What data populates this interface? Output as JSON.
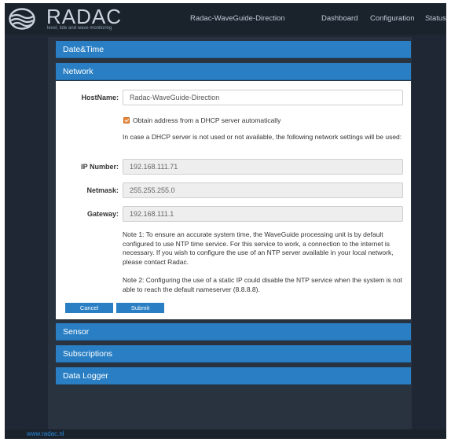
{
  "brand": {
    "name": "RADAC",
    "tagline": "level, tide and wave monitoring"
  },
  "nav": {
    "title": "Radac-WaveGuide-Direction",
    "links": [
      "Dashboard",
      "Configuration",
      "Status"
    ]
  },
  "panels": {
    "datetime": "Date&Time",
    "network": "Network",
    "sensor": "Sensor",
    "subscriptions": "Subscriptions",
    "datalogger": "Data Logger"
  },
  "network": {
    "hostname_label": "HostName:",
    "hostname_value": "Radac-WaveGuide-Direction",
    "dhcp_label": "Obtain address from a DHCP server automatically",
    "dhcp_checked": true,
    "fallback_note": "In case a DHCP server is not used or not available, the following network settings will be used:",
    "ip_label": "IP Number:",
    "ip_value": "192.168.111.71",
    "netmask_label": "Netmask:",
    "netmask_value": "255.255.255.0",
    "gateway_label": "Gateway:",
    "gateway_value": "192.168.111.1",
    "note1": "Note 1: To ensure an accurate system time, the WaveGuide processing unit is by default configured to use NTP time service. For this service to work, a connection to the internet is necessary. If you wish to configure the use of an NTP server available in your local network, please contact Radac.",
    "note2": "Note 2: Configuring the use of a static IP could disable the NTP service when the system is not able to reach the default nameserver (8.8.8.8).",
    "cancel_label": "Cancel",
    "submit_label": "Submit"
  },
  "footer": {
    "link": "www.radac.nl"
  },
  "colors": {
    "accent": "#2a7fc4",
    "background": "#1e2733",
    "checkbox": "#e8873a"
  }
}
